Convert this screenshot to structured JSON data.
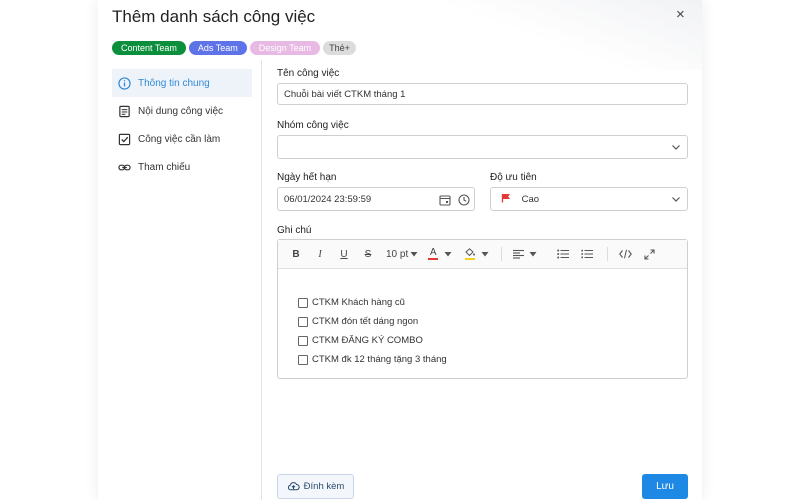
{
  "dialog": {
    "title": "Thêm danh sách công việc",
    "close_label": "×"
  },
  "tags": [
    {
      "label": "Content Team",
      "color": "#0b8f3c"
    },
    {
      "label": "Ads Team",
      "color": "#5f73e8"
    },
    {
      "label": "Design Team",
      "color": "#e8b9e3"
    },
    {
      "label": "Thẻ+",
      "color": "#dcdcdc"
    }
  ],
  "sidebar": {
    "items": [
      {
        "label": "Thông tin chung",
        "icon": "info-icon",
        "active": true
      },
      {
        "label": "Nội dung công việc",
        "icon": "document-icon",
        "active": false
      },
      {
        "label": "Công việc cần làm",
        "icon": "checkbox-icon",
        "active": false
      },
      {
        "label": "Tham chiếu",
        "icon": "link-icon",
        "active": false
      }
    ]
  },
  "form": {
    "task_name": {
      "label": "Tên công việc",
      "value": "Chuỗi bài viết CTKM tháng 1"
    },
    "task_group": {
      "label": "Nhóm công việc",
      "value": ""
    },
    "due_date": {
      "label": "Ngày hết hạn",
      "value": "06/01/2024 23:59:59"
    },
    "priority": {
      "label": "Độ ưu tiên",
      "value": "Cao",
      "flag_color": "#e53935"
    },
    "notes": {
      "label": "Ghi chú",
      "toolbar": {
        "bold": "B",
        "italic": "I",
        "underline": "U",
        "strike": "S",
        "font_size": "10 pt",
        "font_color_label": "A",
        "font_color": "#e53935",
        "highlight_color": "#f2d21c"
      },
      "todos": [
        "CTKM Khách hàng cũ",
        "CTKM đón tết dáng ngon",
        "CTKM ĐĂNG KÝ COMBO",
        "CTKM đk 12 tháng tặng 3 tháng"
      ]
    }
  },
  "footer": {
    "attach_label": "Đính kèm",
    "save_label": "Lưu"
  },
  "colors": {
    "accent": "#1e88e5",
    "active_bg": "#eef3fa",
    "active_text": "#2f8ad8"
  }
}
